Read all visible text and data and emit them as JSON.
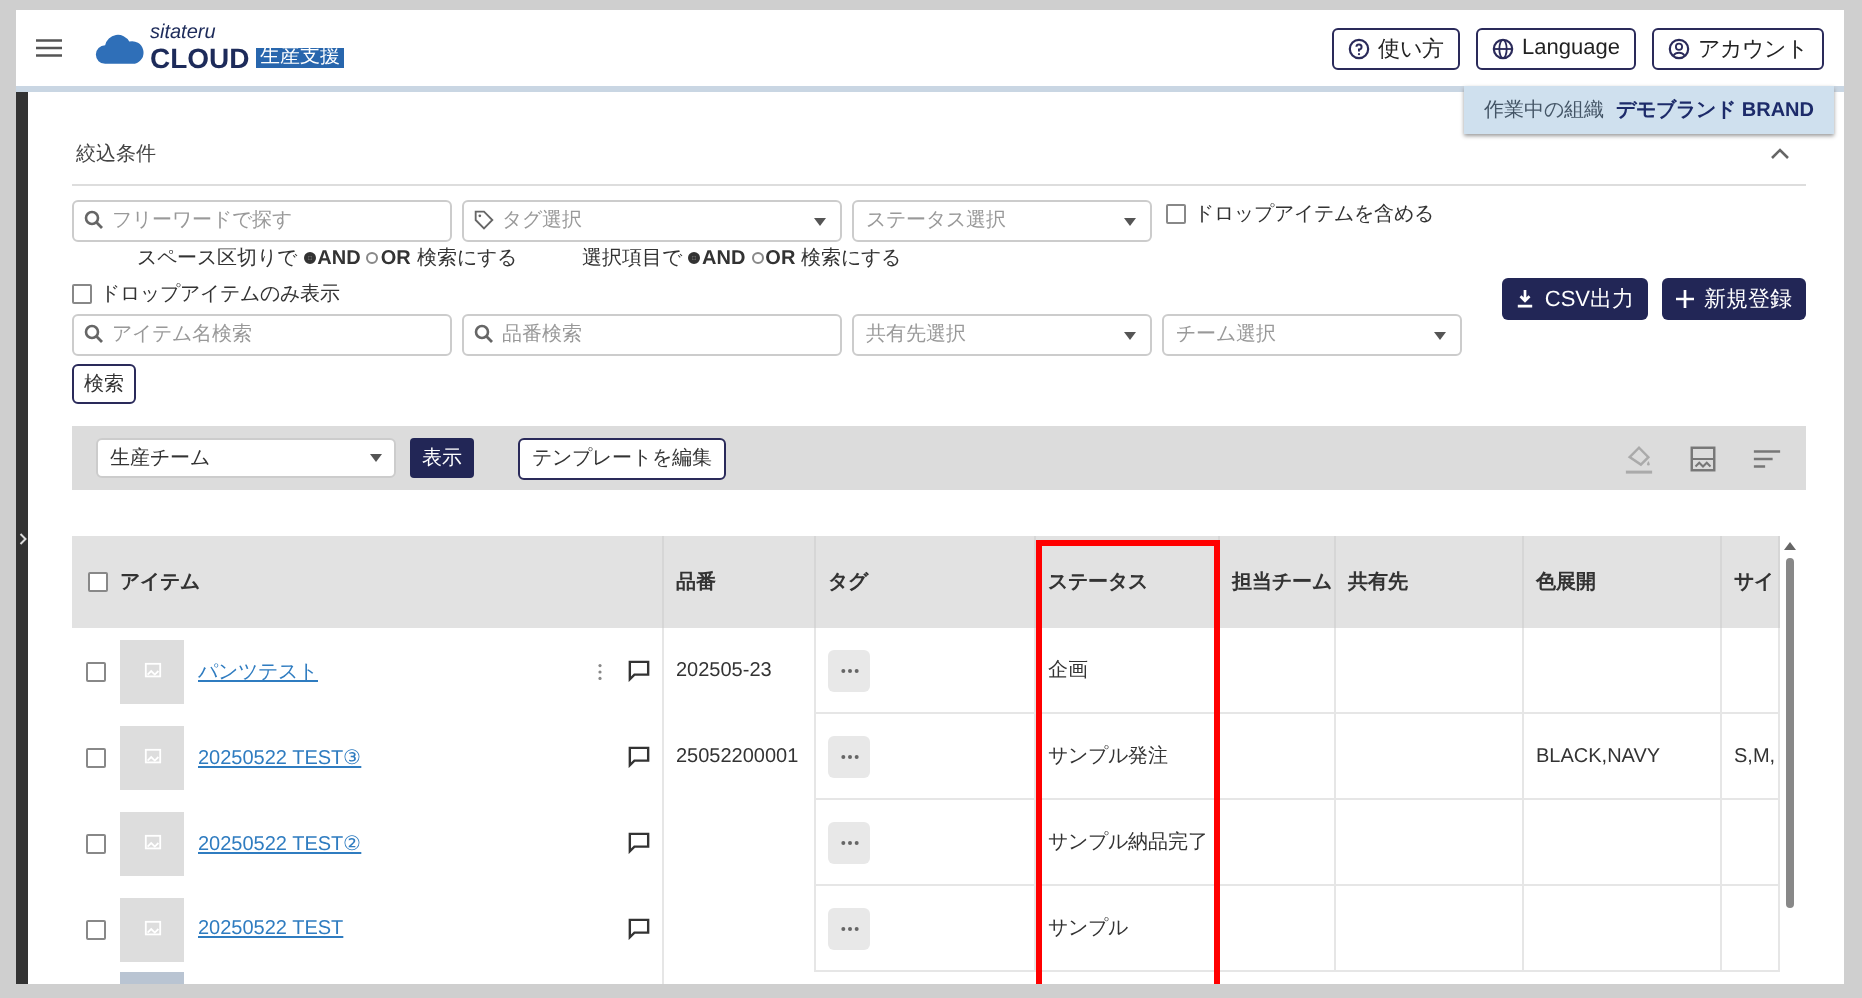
{
  "header": {
    "logo_small": "sitateru",
    "logo_main": "CLOUD",
    "logo_badge": "生産支援",
    "buttons": [
      {
        "kind": "help",
        "label": "使い方"
      },
      {
        "kind": "language",
        "label": "Language"
      },
      {
        "kind": "account",
        "label": "アカウント"
      }
    ]
  },
  "org": {
    "label": "作業中の組織",
    "name": "デモブランド BRAND"
  },
  "filter": {
    "title": "絞込条件",
    "expanded": true,
    "freeword": {
      "placeholder": "フリーワードで探す"
    },
    "tag": {
      "placeholder": "タグ選択"
    },
    "status": {
      "placeholder": "ステータス選択"
    },
    "include_drop": {
      "label": "ドロップアイテムを含める",
      "checked": false
    },
    "hints": [
      {
        "prefix": "スペース区切りで",
        "options": [
          {
            "label": "AND",
            "selected": true
          },
          {
            "label": "OR",
            "selected": false
          }
        ],
        "suffix": "検索にする"
      },
      {
        "prefix": "選択項目で",
        "options": [
          {
            "label": "AND",
            "selected": true
          },
          {
            "label": "OR",
            "selected": false
          }
        ],
        "suffix": "検索にする"
      }
    ],
    "only_drop": {
      "label": "ドロップアイテムのみ表示",
      "checked": false
    },
    "item_name": {
      "placeholder": "アイテム名検索"
    },
    "code": {
      "placeholder": "品番検索"
    },
    "share": {
      "placeholder": "共有先選択"
    },
    "team": {
      "placeholder": "チーム選択"
    },
    "search_button": "検索"
  },
  "actions": [
    {
      "kind": "download",
      "label": "CSV出力"
    },
    {
      "kind": "add",
      "label": "新規登録"
    }
  ],
  "toolbar": {
    "template_select": "生産チーム",
    "show_button": "表示",
    "edit_button": "テンプレートを編集"
  },
  "table": {
    "all_checked": false,
    "columns": [
      {
        "label": "アイテム",
        "highlighted": false
      },
      {
        "label": "品番",
        "highlighted": false
      },
      {
        "label": "タグ",
        "highlighted": false
      },
      {
        "label": "ステータス",
        "highlighted": true
      },
      {
        "label": "担当チーム",
        "highlighted": false
      },
      {
        "label": "共有先",
        "highlighted": false
      },
      {
        "label": "色展開",
        "highlighted": false
      },
      {
        "label": "サイ",
        "highlighted": false
      }
    ],
    "rows": [
      {
        "checked": false,
        "name": "パンツテスト",
        "menu": true,
        "code": "202505‐23",
        "status": "企画",
        "team": "",
        "share": "",
        "colors": "",
        "sizes": ""
      },
      {
        "checked": false,
        "name": "20250522 TEST③",
        "menu": false,
        "code": "25052200001",
        "status": "サンプル発注",
        "team": "",
        "share": "",
        "colors": "BLACK,NAVY",
        "sizes": "S,M,"
      },
      {
        "checked": false,
        "name": "20250522 TEST②",
        "menu": false,
        "code": "",
        "status": "サンプル納品完了",
        "team": "",
        "share": "",
        "colors": "",
        "sizes": ""
      },
      {
        "checked": false,
        "name": "20250522 TEST",
        "menu": false,
        "code": "",
        "status": "サンプル",
        "team": "",
        "share": "",
        "colors": "",
        "sizes": ""
      },
      {
        "photo": true
      }
    ]
  }
}
